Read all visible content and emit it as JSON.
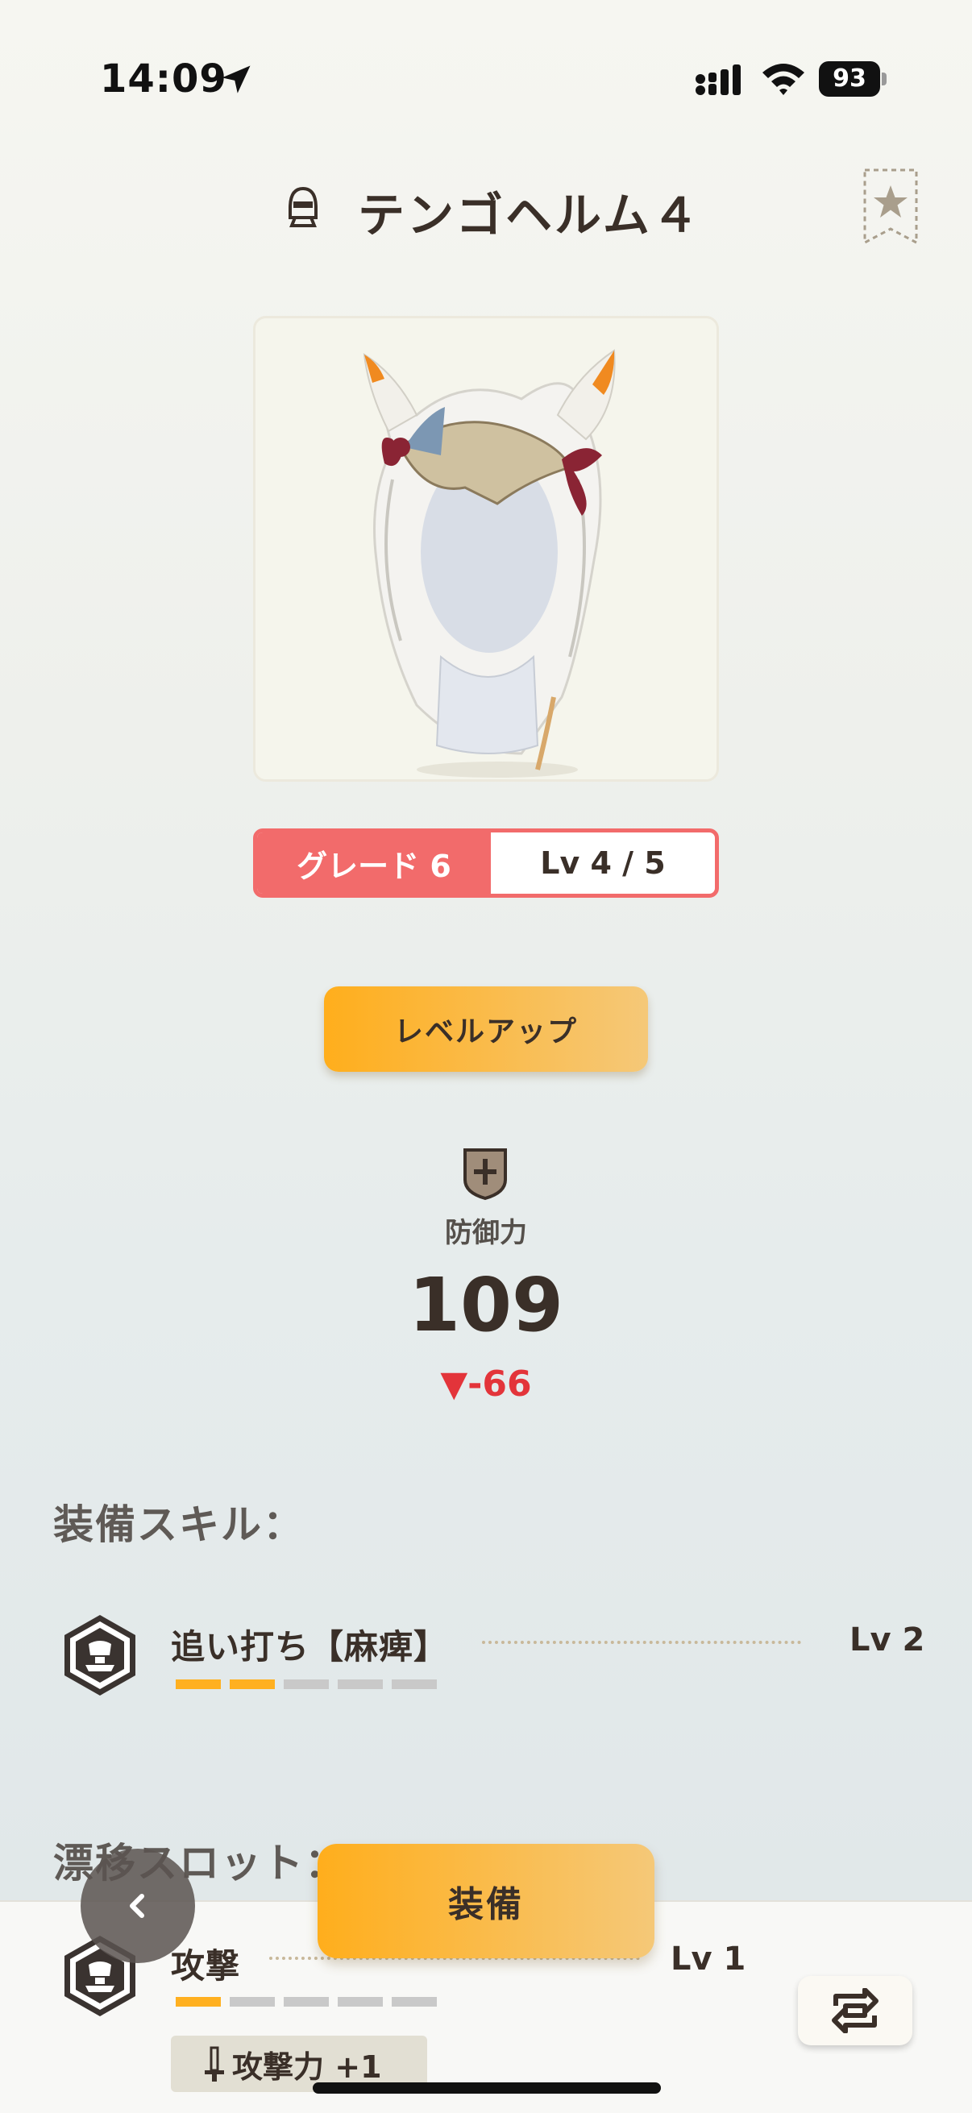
{
  "status_bar": {
    "time": "14:09",
    "battery": "93"
  },
  "header": {
    "title": "テンゴヘルム４"
  },
  "grade": {
    "grade_label": "グレード 6",
    "level_label": "Lv 4 / 5"
  },
  "level_up_label": "レベルアップ",
  "defense": {
    "label": "防御力",
    "value": "109",
    "delta": "▼-66"
  },
  "equip_skills": {
    "title": "装備スキル：",
    "items": [
      {
        "name": "追い打ち【麻痺】",
        "level": "Lv 2",
        "pips_filled": 2,
        "pips_total": 5
      }
    ]
  },
  "drift_slots": {
    "title": "漂移スロット：",
    "items": [
      {
        "name": "攻撃",
        "level": "Lv 1",
        "pips_filled": 1,
        "pips_total": 5,
        "bonus": "攻撃力 +1"
      }
    ]
  },
  "equip_label": "装備",
  "colors": {
    "accent_orange": "#ffae1c",
    "grade_red": "#f26b6b",
    "delta_red": "#e3343a"
  }
}
